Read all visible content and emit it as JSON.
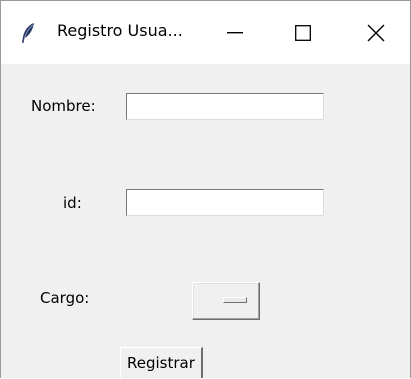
{
  "window": {
    "title": "Registro Usua...",
    "icon": "feather-icon",
    "controls": {
      "minimize": "minimize-icon",
      "maximize": "maximize-icon",
      "close": "close-icon"
    }
  },
  "form": {
    "nombre_label": "Nombre:",
    "nombre_value": "",
    "id_label": "id:",
    "id_value": "",
    "cargo_label": "Cargo:",
    "cargo_value": "",
    "submit_label": "Registrar"
  }
}
